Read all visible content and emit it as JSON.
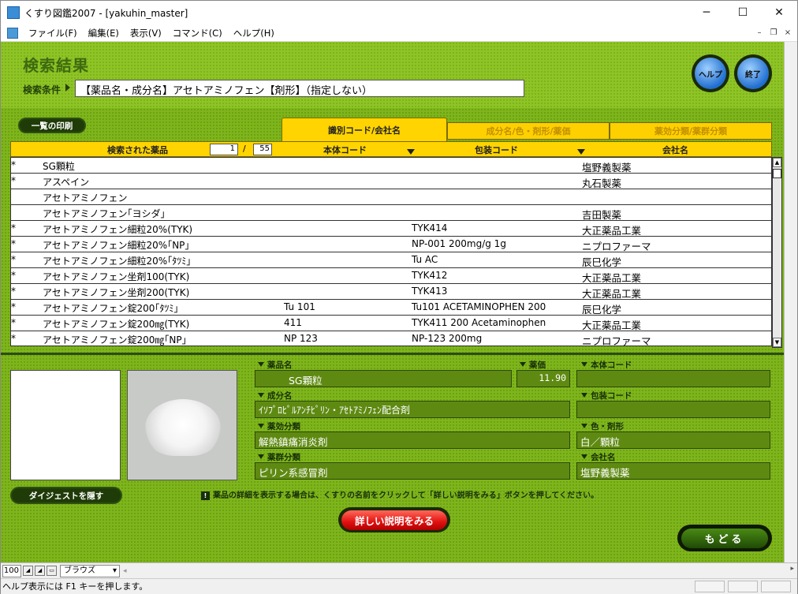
{
  "window": {
    "title": "くすり図鑑2007 - [yakuhin_master]",
    "controls": {
      "minimize": "─",
      "maximize": "☐",
      "close": "✕"
    },
    "mdi_controls": {
      "minimize": "–",
      "restore": "❐",
      "close": "×"
    }
  },
  "menu": [
    "ファイル(F)",
    "編集(E)",
    "表示(V)",
    "コマンド(C)",
    "ヘルプ(H)"
  ],
  "header": {
    "title": "検索結果",
    "condition_label": "検索条件",
    "condition_value": "【薬品名・成分名】アセトアミノフェン【剤形】（指定しない）",
    "help_button": "ヘルプ",
    "exit_button": "終了"
  },
  "print_button": "一覧の印刷",
  "tabs": [
    {
      "label": "識別コード/会社名",
      "active": true
    },
    {
      "label": "成分名/色・剤形/薬価",
      "active": false
    },
    {
      "label": "薬効分類/薬群分類",
      "active": false
    }
  ],
  "list_header": {
    "title": "検索された薬品",
    "page": "1",
    "separator": "/",
    "total": "55",
    "col_body": "本体コード",
    "col_pack": "包装コード",
    "col_company": "会社名"
  },
  "rows": [
    {
      "mark": "*",
      "name": "SG顆粒",
      "body": "",
      "pack": "",
      "company": "塩野義製薬"
    },
    {
      "mark": "*",
      "name": "アスペイン",
      "body": "",
      "pack": "",
      "company": "丸石製薬"
    },
    {
      "mark": "",
      "name": "アセトアミノフェン",
      "body": "",
      "pack": "",
      "company": ""
    },
    {
      "mark": "",
      "name": "アセトアミノフェン｢ヨシダ｣",
      "body": "",
      "pack": "",
      "company": "吉田製薬"
    },
    {
      "mark": "*",
      "name": "アセトアミノフェン細粒20%(TYK)",
      "body": "",
      "pack": "TYK414",
      "company": "大正薬品工業"
    },
    {
      "mark": "*",
      "name": "アセトアミノフェン細粒20%｢NP｣",
      "body": "",
      "pack": "NP-001 200mg/g 1g",
      "company": "ニプロファーマ"
    },
    {
      "mark": "*",
      "name": "アセトアミノフェン細粒20%｢ﾀﾂﾐ｣",
      "body": "",
      "pack": "Tu AC",
      "company": "辰巳化学"
    },
    {
      "mark": "*",
      "name": "アセトアミノフェン坐剤100(TYK)",
      "body": "",
      "pack": "TYK412",
      "company": "大正薬品工業"
    },
    {
      "mark": "*",
      "name": "アセトアミノフェン坐剤200(TYK)",
      "body": "",
      "pack": "TYK413",
      "company": "大正薬品工業"
    },
    {
      "mark": "*",
      "name": "アセトアミノフェン錠200｢ﾀﾂﾐ｣",
      "body": "Tu 101",
      "pack": "Tu101 ACETAMINOPHEN 200",
      "company": "辰巳化学"
    },
    {
      "mark": "*",
      "name": "アセトアミノフェン錠200㎎(TYK)",
      "body": "411",
      "pack": "TYK411 200 Acetaminophen",
      "company": "大正薬品工業"
    },
    {
      "mark": "*",
      "name": "アセトアミノフェン錠200㎎｢NP｣",
      "body": "NP 123",
      "pack": "NP-123 200mg",
      "company": "ニプロファーマ"
    }
  ],
  "detail": {
    "name_label": "薬品名",
    "name_value": "SG顆粒",
    "price_label": "薬価",
    "price_value": "11.90",
    "body_label": "本体コード",
    "body_value": "",
    "ingredient_label": "成分名",
    "ingredient_value": "ｲｿﾌﾟﾛﾋﾟﾙｱﾝﾁﾋﾟﾘﾝ・ｱｾﾄｱﾐﾉﾌｪﾝ配合剤",
    "pack_label": "包装コード",
    "pack_value": "",
    "effect_label": "薬効分類",
    "effect_value": "解熱鎮痛消炎剤",
    "color_label": "色・剤形",
    "color_value": "白／顆粒",
    "group_label": "薬群分類",
    "group_value": "ピリン系感冒剤",
    "company_label": "会社名",
    "company_value": "塩野義製薬"
  },
  "digest_button": "ダイジェストを隠す",
  "note_icon": "!",
  "note": "薬品の詳細を表示する場合は、くすりの名前をクリックして「詳しい説明をみる」ボタンを押してください。",
  "detail_button": "詳しい説明をみる",
  "back_button": "もどる",
  "bottom_bar": {
    "zoom": "100",
    "mode": "ブラウズ"
  },
  "status": "ヘルプ表示には F1 キーを押します。",
  "colors": {
    "green_bg": "#7fb51c",
    "yellow_tab": "#ffd400",
    "field_green": "#5e8a12",
    "red_button": "#e01010"
  }
}
